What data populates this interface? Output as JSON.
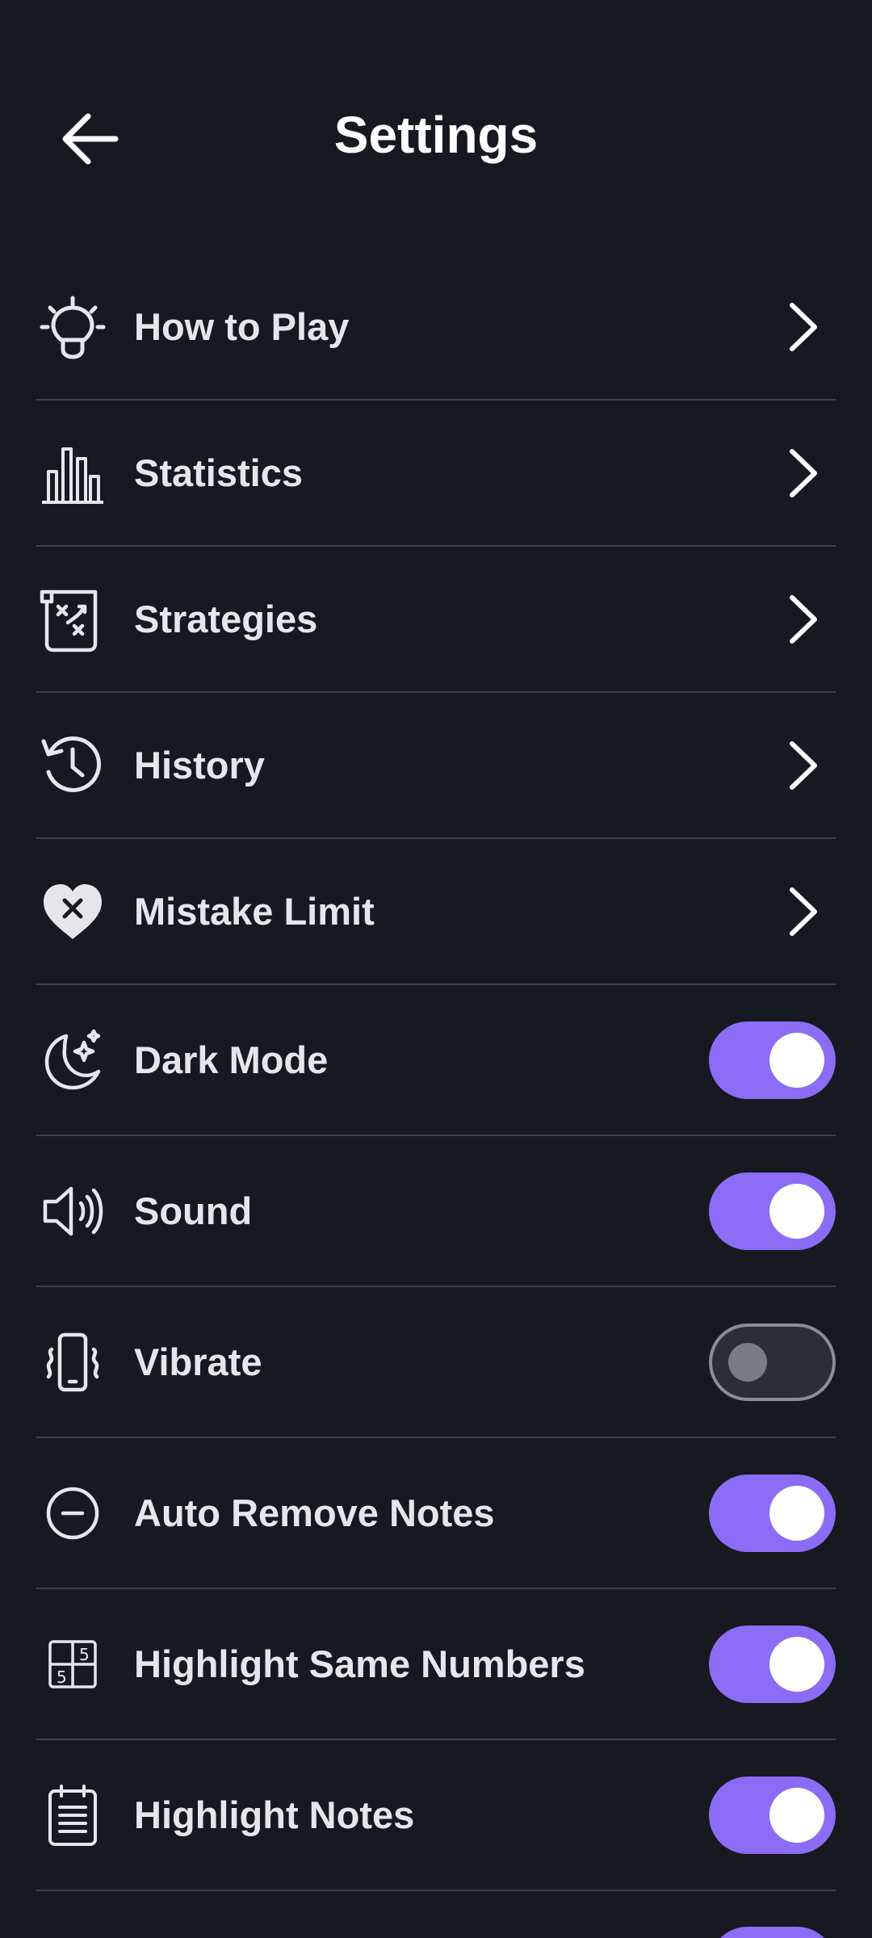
{
  "header": {
    "title": "Settings",
    "back_icon": "arrow-left-icon"
  },
  "theme": {
    "background": "#161920",
    "divider": "#3c404a",
    "accent": "#8b6cf4",
    "text": "#e6e6ea"
  },
  "nav_items": [
    {
      "label": "How to Play",
      "icon": "lightbulb-icon"
    },
    {
      "label": "Statistics",
      "icon": "bar-chart-icon"
    },
    {
      "label": "Strategies",
      "icon": "strategy-board-icon"
    },
    {
      "label": "History",
      "icon": "history-clock-icon"
    },
    {
      "label": "Mistake Limit",
      "icon": "heart-x-icon"
    }
  ],
  "toggle_items": [
    {
      "label": "Dark Mode",
      "icon": "moon-sparkle-icon",
      "on": true
    },
    {
      "label": "Sound",
      "icon": "speaker-icon",
      "on": true
    },
    {
      "label": "Vibrate",
      "icon": "phone-vibrate-icon",
      "on": false
    },
    {
      "label": "Auto Remove Notes",
      "icon": "minus-circle-icon",
      "on": true
    },
    {
      "label": "Highlight Same Numbers",
      "icon": "number-grid-icon",
      "on": true
    },
    {
      "label": "Highlight Notes",
      "icon": "notepad-icon",
      "on": true
    }
  ]
}
